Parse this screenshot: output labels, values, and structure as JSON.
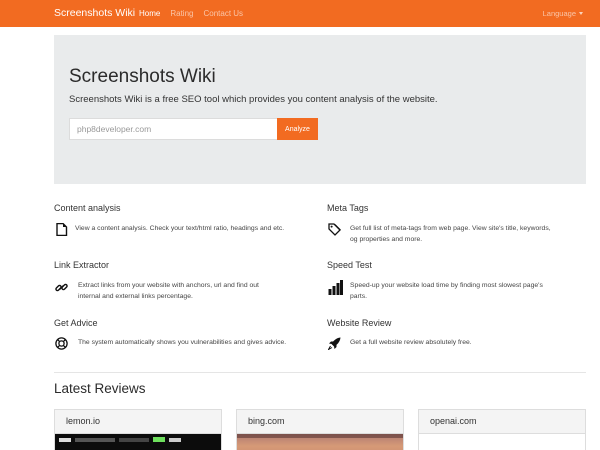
{
  "navbar": {
    "brand": "Screenshots Wiki",
    "links": [
      {
        "label": "Home",
        "active": true
      },
      {
        "label": "Rating",
        "active": false
      },
      {
        "label": "Contact Us",
        "active": false
      }
    ],
    "language_label": "Language",
    "color": "#f26b21"
  },
  "hero": {
    "title": "Screenshots Wiki",
    "subtitle": "Screenshots Wiki is a free SEO tool which provides you content analysis of the website.",
    "input_value": "php8developer.com",
    "button_label": "Analyze"
  },
  "features": [
    {
      "title": "Content analysis",
      "icon": "document-icon",
      "desc_lines": [
        "View a content analysis. Check your text/html ratio, headings and etc."
      ]
    },
    {
      "title": "Meta Tags",
      "icon": "tags-icon",
      "desc_lines": [
        "Get full list of meta-tags from web page. View site's title, keywords,",
        "og properties and more."
      ]
    },
    {
      "title": "Link Extractor",
      "icon": "link-icon",
      "desc_lines": [
        "Extract links from your website with anchors, url and find out",
        "internal and external links percentage."
      ]
    },
    {
      "title": "Speed Test",
      "icon": "bar-chart-icon",
      "desc_lines": [
        "Speed-up your website load time by finding most slowest page's",
        "parts."
      ]
    },
    {
      "title": "Get Advice",
      "icon": "help-icon",
      "desc_lines": [
        "The system automatically shows you vulnerabilities and gives advice."
      ]
    },
    {
      "title": "Website Review",
      "icon": "rocket-icon",
      "desc_lines": [
        "Get a full website review absolutely free."
      ]
    }
  ],
  "latest_reviews": {
    "title": "Latest Reviews",
    "cards": [
      {
        "domain": "lemon.io"
      },
      {
        "domain": "bing.com"
      },
      {
        "domain": "openai.com"
      }
    ]
  }
}
